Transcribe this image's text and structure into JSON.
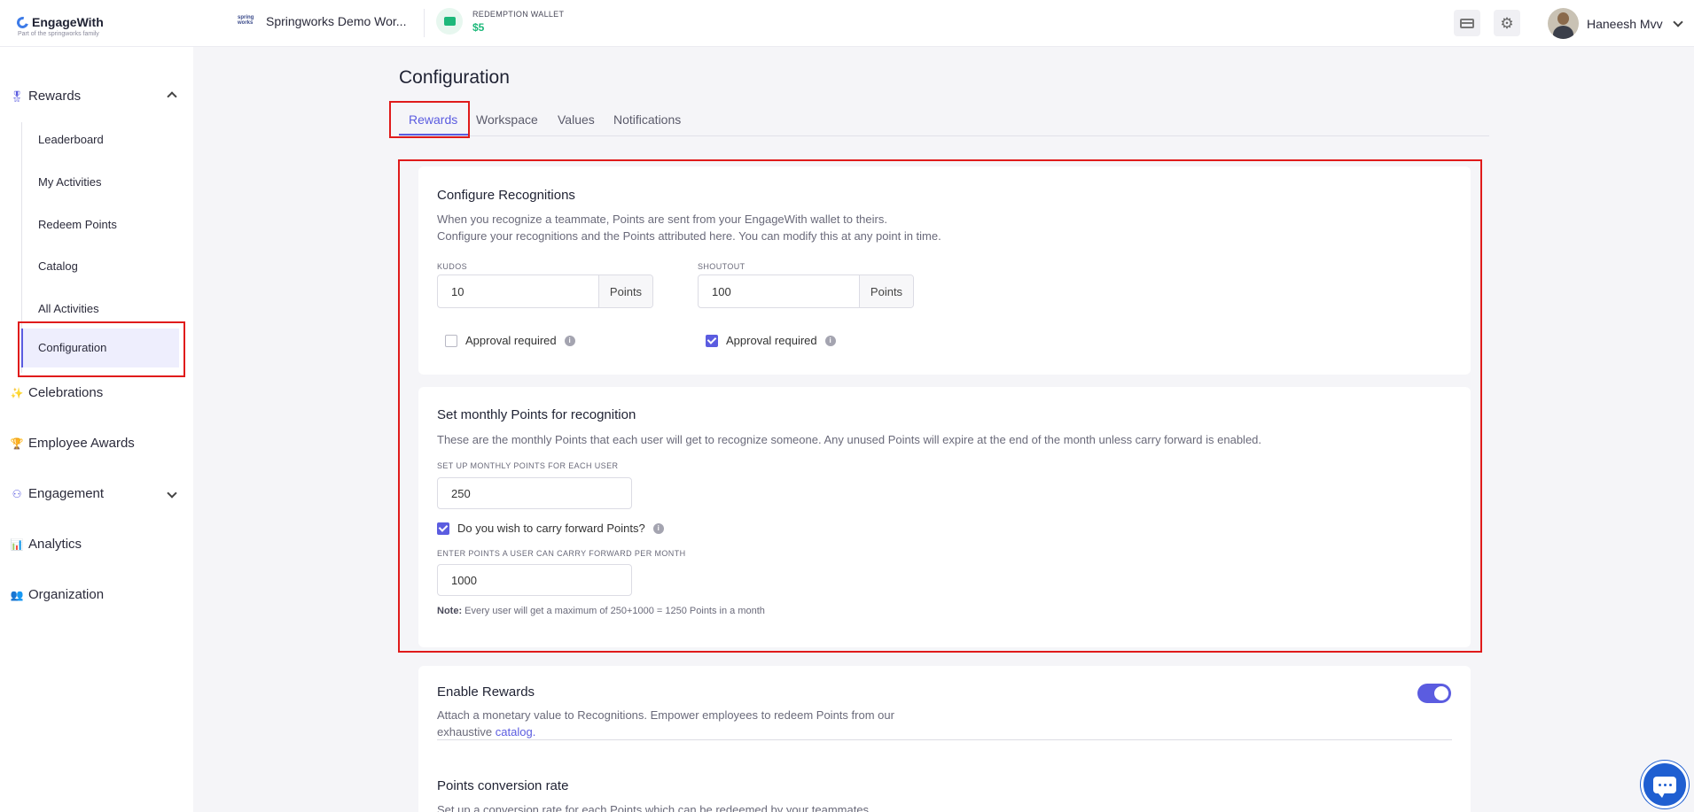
{
  "brand": {
    "name": "EngageWith",
    "tagline": "Part of the springworks family"
  },
  "workspace": {
    "logo_text": "spring works",
    "name": "Springworks Demo Wor..."
  },
  "wallet": {
    "label": "REDEMPTION WALLET",
    "value": "$5"
  },
  "user": {
    "name": "Haneesh Mvv"
  },
  "sidebar": {
    "rewards": "Rewards",
    "sub_items": [
      "Leaderboard",
      "My Activities",
      "Redeem Points",
      "Catalog",
      "All Activities"
    ],
    "active_item": "Configuration",
    "celebrations": "Celebrations",
    "employee_awards": "Employee Awards",
    "engagement": "Engagement",
    "analytics": "Analytics",
    "organization": "Organization"
  },
  "page": {
    "title": "Configuration"
  },
  "tabs": [
    "Rewards",
    "Workspace",
    "Values",
    "Notifications"
  ],
  "recognitions": {
    "title": "Configure Recognitions",
    "desc1": "When you recognize a teammate, Points are sent from your EngageWith wallet to theirs.",
    "desc2": "Configure your recognitions and the Points attributed here. You can modify this at any point in time.",
    "kudos_label": "KUDOS",
    "kudos_value": "10",
    "shoutout_label": "SHOUTOUT",
    "shoutout_value": "100",
    "points_suffix": "Points",
    "approval_label": "Approval required",
    "kudos_approval": false,
    "shoutout_approval": true
  },
  "monthly": {
    "title": "Set monthly Points for recognition",
    "desc": "These are the monthly Points that each user will get to recognize someone. Any unused Points will expire at the end of the month unless carry forward is enabled.",
    "setup_label": "SET UP MONTHLY POINTS FOR EACH USER",
    "setup_value": "250",
    "carry_label": "Do you wish to carry forward Points?",
    "carry_checked": true,
    "carry_points_label": "ENTER POINTS A USER CAN CARRY FORWARD PER MONTH",
    "carry_points_value": "1000",
    "note_prefix": "Note:",
    "note_text": "Every user will get a maximum of 250+1000 = 1250 Points in a month"
  },
  "enable_rewards": {
    "title": "Enable Rewards",
    "desc1": "Attach a monetary value to Recognitions. Empower employees to redeem Points from our",
    "desc2_prefix": "exhaustive",
    "link": "catalog.",
    "enabled": true
  },
  "conversion": {
    "title": "Points conversion rate",
    "desc": "Set up a conversion rate for each Points which can be redeemed by your teammates"
  },
  "colors": {
    "accent": "#5b5ce0",
    "highlight": "#e01b1b",
    "wallet": "#1db87a"
  }
}
